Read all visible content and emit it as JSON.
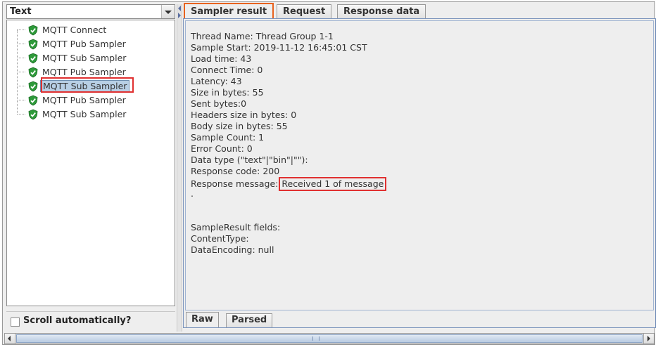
{
  "renderer": {
    "selected": "Text"
  },
  "tree": {
    "items": [
      {
        "label": "MQTT Connect",
        "status_icon": "green-shield-check-icon"
      },
      {
        "label": "MQTT Pub Sampler",
        "status_icon": "green-shield-check-icon"
      },
      {
        "label": "MQTT Sub Sampler",
        "status_icon": "green-shield-check-icon"
      },
      {
        "label": "MQTT Pub Sampler",
        "status_icon": "green-shield-check-icon"
      },
      {
        "label": "MQTT Sub Sampler",
        "status_icon": "green-shield-check-icon",
        "selected": true
      },
      {
        "label": "MQTT Pub Sampler",
        "status_icon": "green-shield-check-icon"
      },
      {
        "label": "MQTT Sub Sampler",
        "status_icon": "green-shield-check-icon"
      }
    ]
  },
  "scroll_auto": {
    "label": "Scroll automatically?",
    "checked": false
  },
  "tabs": [
    "Sampler result",
    "Request",
    "Response data"
  ],
  "active_tab": "Sampler result",
  "result": {
    "lines": [
      "Thread Name: Thread Group 1-1",
      "Sample Start: 2019-11-12 16:45:01 CST",
      "Load time: 43",
      "Connect Time: 0",
      "Latency: 43",
      "Size in bytes: 55",
      "Sent bytes:0",
      "Headers size in bytes: 0",
      "Body size in bytes: 55",
      "Sample Count: 1",
      "Error Count: 0",
      "Data type (\"text\"|\"bin\"|\"\"):",
      "Response code: 200"
    ],
    "response_message_label": "Response message: ",
    "response_message_value": "Received 1 of message",
    "after_lines": [
      ".",
      "",
      "",
      "SampleResult fields:",
      "ContentType:",
      "DataEncoding: null"
    ]
  },
  "subtabs": [
    "Raw",
    "Parsed"
  ],
  "active_subtab": "Raw",
  "colors": {
    "highlight_red": "#e03030",
    "active_tab_orange": "#e8621e",
    "check_green": "#2e9a3a",
    "selection": "#b8cfe5"
  }
}
